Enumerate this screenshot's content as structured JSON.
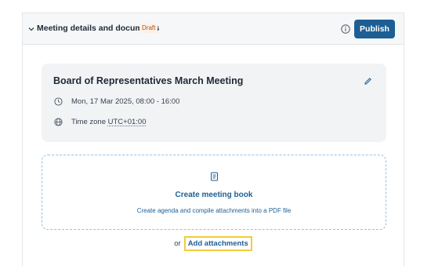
{
  "header": {
    "title": "Meeting details and documents",
    "badge": "Draft",
    "publish_label": "Publish",
    "icons": {
      "collapse": "chevron-down-icon",
      "info": "info-icon"
    }
  },
  "meeting": {
    "title": "Board of Representatives March Meeting",
    "datetime": "Mon, 17 Mar 2025, 08:00 - 16:00",
    "timezone_label": "Time zone",
    "timezone_value": "UTC+01:00",
    "icons": {
      "edit": "pencil-icon",
      "time": "clock-icon",
      "timezone": "globe-icon"
    }
  },
  "meeting_book": {
    "title": "Create meeting book",
    "subtitle": "Create agenda and compile attachments into a PDF file",
    "icon": "book-icon"
  },
  "attachments": {
    "or_text": "or",
    "add_label": "Add attachments"
  },
  "colors": {
    "primary": "#1d5f94",
    "draft_badge_text": "#b3541e",
    "draft_badge_bg": "#fdf1e6",
    "focus_outline": "#f0cd3c",
    "dashed_border": "#8ec0e6",
    "card_bg": "#f2f3f5"
  }
}
